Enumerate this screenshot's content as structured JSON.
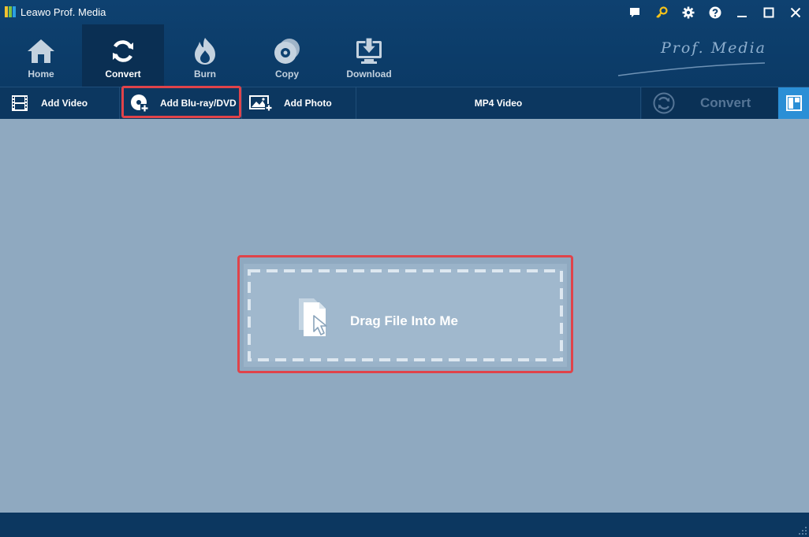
{
  "window": {
    "title": "Leawo Prof. Media"
  },
  "nav": {
    "items": [
      {
        "label": "Home",
        "icon": "home-icon"
      },
      {
        "label": "Convert",
        "icon": "convert-icon",
        "active": true
      },
      {
        "label": "Burn",
        "icon": "burn-icon"
      },
      {
        "label": "Copy",
        "icon": "copy-icon"
      },
      {
        "label": "Download",
        "icon": "download-icon"
      }
    ],
    "brand": "Prof. Media"
  },
  "toolbar": {
    "add_video": "Add Video",
    "add_bluray": "Add Blu-ray/DVD",
    "add_photo": "Add Photo",
    "format": "MP4 Video",
    "convert": "Convert"
  },
  "dropzone": {
    "text": "Drag File Into Me"
  },
  "colors": {
    "header_bg": "#0e4170",
    "toolbar_bg": "#0c3760",
    "workspace_bg": "#8fa9c0",
    "highlight": "#e0434a",
    "layout_button": "#2b8fd6"
  }
}
